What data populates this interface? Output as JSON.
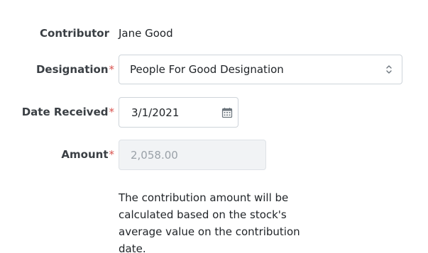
{
  "contributor": {
    "label": "Contributor",
    "value": "Jane Good"
  },
  "designation": {
    "label": "Designation",
    "required_mark": "*",
    "selected": "People For Good Designation",
    "icon": "chevron-updown-icon"
  },
  "date_received": {
    "label": "Date Received",
    "required_mark": "*",
    "value": "3/1/2021",
    "icon": "calendar-icon"
  },
  "amount": {
    "label": "Amount",
    "required_mark": "*",
    "value": "2,058.00"
  },
  "help_text": "The contribution amount will be calculated based on the stock's average value on the contribution date.",
  "colors": {
    "required": "#d9534f",
    "border": "#ced4da",
    "disabled_bg": "#f1f3f5"
  }
}
